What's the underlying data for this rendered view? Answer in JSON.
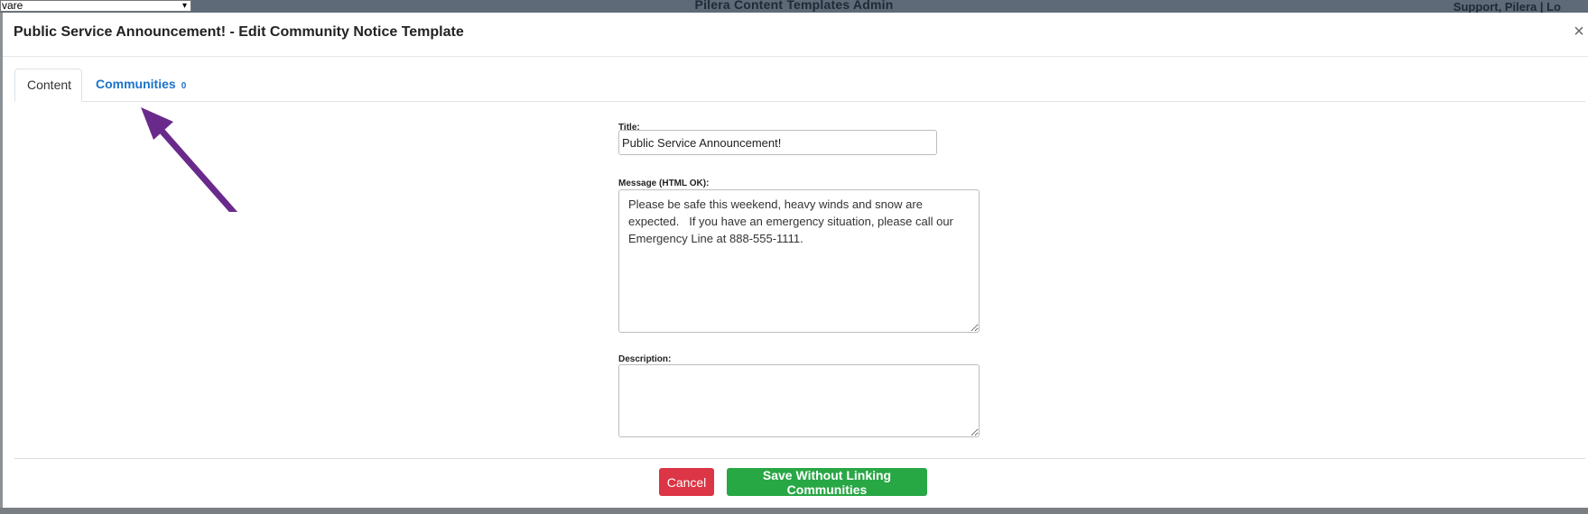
{
  "background": {
    "select_value": "vare",
    "app_title": "Pilera Content Templates Admin",
    "support_text": "Support, Pilera   |   Lo"
  },
  "modal": {
    "title": "Public Service Announcement! - Edit Community Notice Template",
    "close_label": "×",
    "tabs": [
      {
        "label": "Content",
        "active": true
      },
      {
        "label": "Communities",
        "count": "0",
        "active": false
      }
    ],
    "fields": {
      "title_label": "Title:",
      "title_value": "Public Service Announcement!",
      "message_label": "Message (HTML OK):",
      "message_value": "Please be safe this weekend, heavy winds and snow are expected.   If you have an emergency situation, please call our Emergency Line at 888-555-1111.",
      "description_label": "Description:",
      "description_value": ""
    },
    "buttons": {
      "cancel": "Cancel",
      "save": "Save Without Linking Communities"
    }
  },
  "colors": {
    "accent_link": "#1a73c9",
    "cancel": "#dc3545",
    "save": "#28a745",
    "annotation_arrow": "#6a2a8c"
  }
}
